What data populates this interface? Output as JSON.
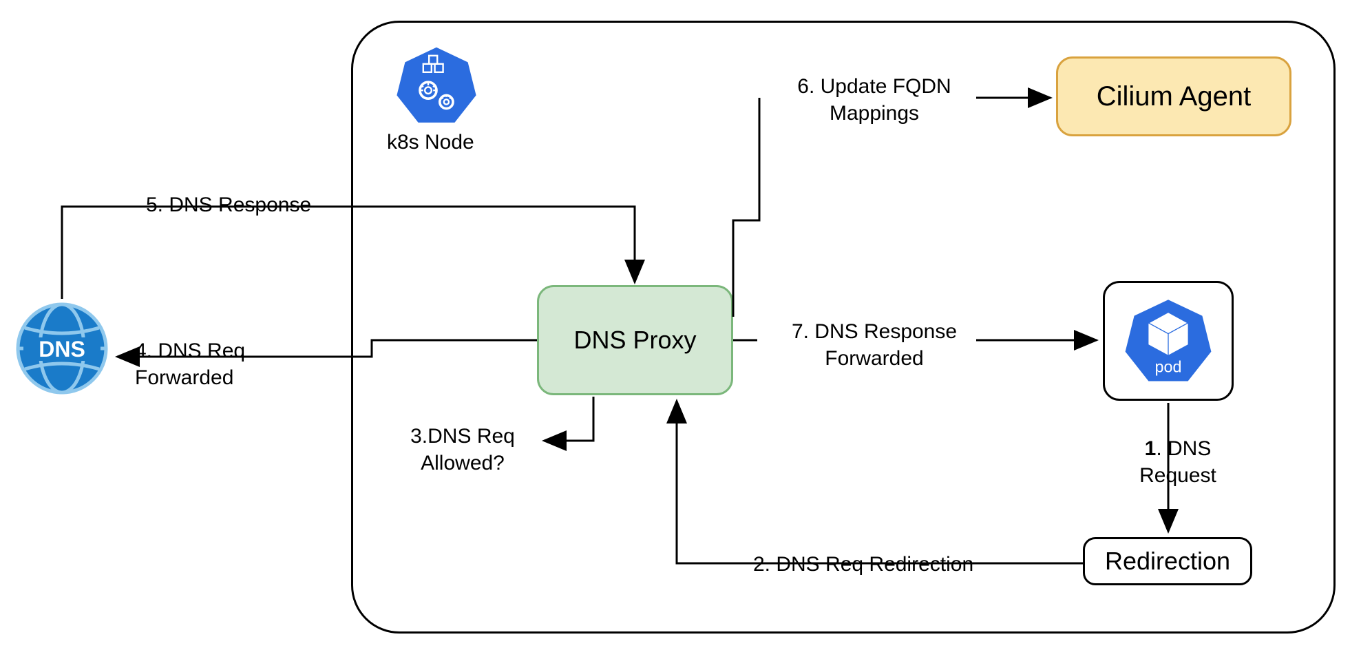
{
  "nodes": {
    "k8s_label": "k8s Node",
    "dns_proxy": "DNS Proxy",
    "cilium_agent": "Cilium Agent",
    "redirection": "Redirection",
    "dns_globe_text": "DNS",
    "pod_text": "pod"
  },
  "edges": {
    "step1_line1": "1",
    "step1_line2": ". DNS Request",
    "step2": "2. DNS Req Redirection",
    "step3_line1": "3.DNS Req",
    "step3_line2": "Allowed?",
    "step4_line1": "4. DNS Req",
    "step4_line2": "Forwarded",
    "step5": "5. DNS Response",
    "step6_line1": "6. Update FQDN",
    "step6_line2": "Mappings",
    "step7_line1": "7. DNS Response",
    "step7_line2": "Forwarded"
  }
}
